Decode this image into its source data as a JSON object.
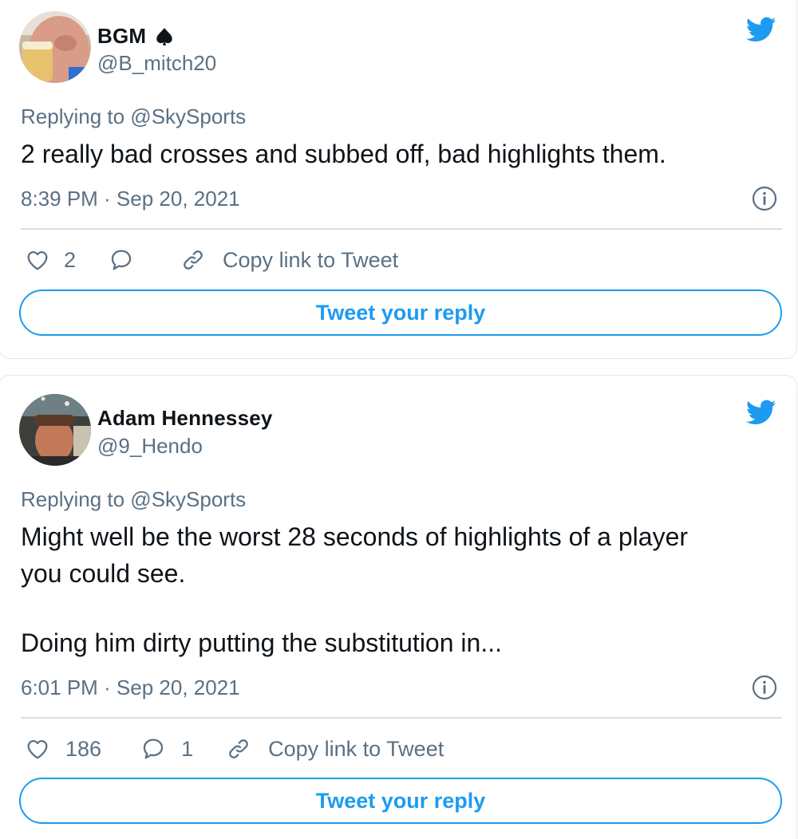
{
  "tweets": [
    {
      "name": "BGM",
      "name_suffix_icon": "spade-icon",
      "handle": "@B_mitch20",
      "replying_to": "Replying to @SkySports",
      "text_lines": [
        "2 really bad crosses and subbed off, bad highlights them."
      ],
      "timestamp": "8:39 PM · Sep 20, 2021",
      "like_count": "2",
      "reply_count": "",
      "copy_link_label": "Copy link to Tweet",
      "reply_button_label": "Tweet your reply"
    },
    {
      "name": "Adam Hennessey",
      "handle": "@9_Hendo",
      "replying_to": "Replying to @SkySports",
      "text_lines": [
        "Might well be the worst 28 seconds of highlights of a player",
        "you could see.",
        "",
        "Doing him dirty putting the substitution in..."
      ],
      "timestamp": "6:01 PM · Sep 20, 2021",
      "like_count": "186",
      "reply_count": "1",
      "copy_link_label": "Copy link to Tweet",
      "reply_button_label": "Tweet your reply"
    }
  ],
  "colors": {
    "accent": "#1d9bf0",
    "secondary_text": "#5b7083",
    "border": "#e1e8ed"
  }
}
